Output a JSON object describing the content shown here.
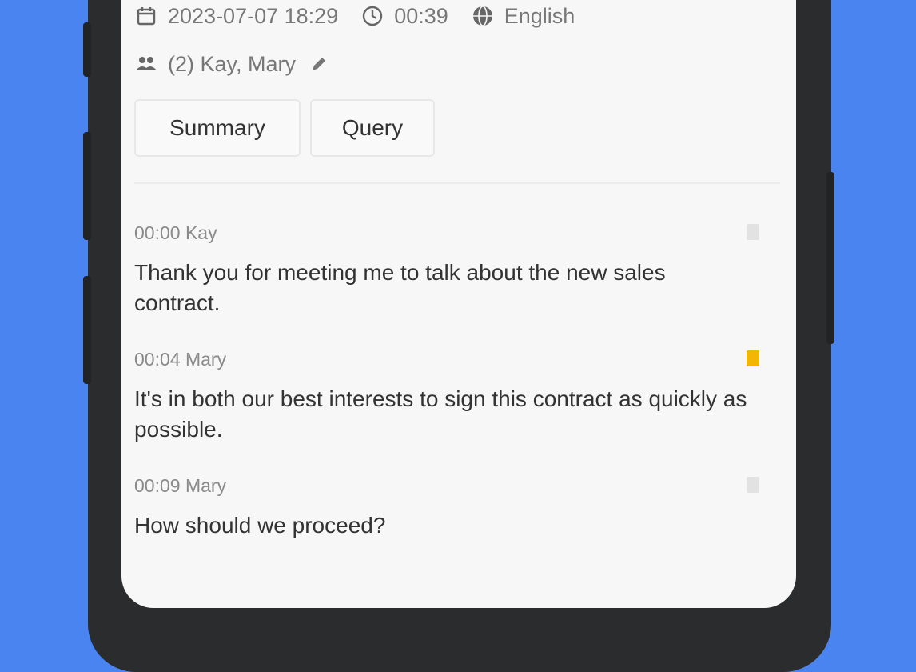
{
  "meta": {
    "date": "2023-07-07 18:29",
    "duration": "00:39",
    "language": "English"
  },
  "participants": {
    "text": "(2) Kay, Mary"
  },
  "actions": {
    "summary_label": "Summary",
    "query_label": "Query"
  },
  "transcript": [
    {
      "time": "00:00",
      "speaker": "Kay",
      "text": "Thank you for meeting me to talk about the new sales contract.",
      "bookmarked": false
    },
    {
      "time": "00:04",
      "speaker": "Mary",
      "text": "It's in both our best interests to sign this contract as quickly as possible.",
      "bookmarked": true
    },
    {
      "time": "00:09",
      "speaker": "Mary",
      "text": "How should we proceed?",
      "bookmarked": false
    }
  ],
  "colors": {
    "background": "#4a84f0",
    "bookmark_active": "#f2b705",
    "bookmark_inactive": "#e2e2e2"
  },
  "icons": {
    "date": "calendar-icon",
    "duration": "clock-icon",
    "language": "globe-icon",
    "participants": "people-icon",
    "edit": "pencil-icon",
    "bookmark": "bookmark-icon"
  }
}
